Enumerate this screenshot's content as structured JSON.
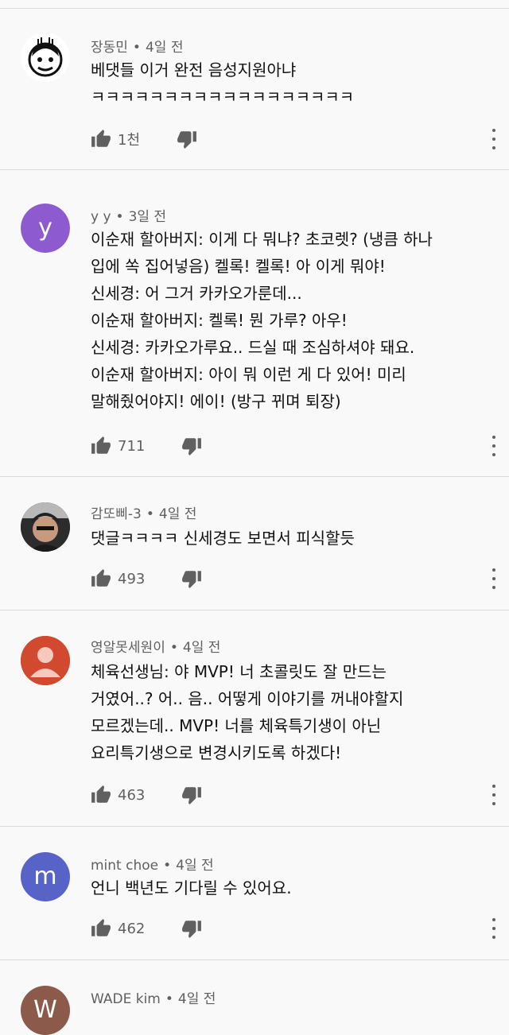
{
  "comments": [
    {
      "author": "장동민",
      "time": "4일 전",
      "text": "베댓들 이거 완전 음성지원아냐\nㅋㅋㅋㅋㅋㅋㅋㅋㅋㅋㅋㅋㅋㅋㅋㅋㅋㅋ",
      "likes": "1천",
      "avatar_letter": "",
      "avatar_color": "#ffffff"
    },
    {
      "author": "y y",
      "time": "3일 전",
      "text": "이순재 할아버지: 이게 다 뭐냐? 초코렛? (냉큼 하나\n입에 쏙 집어넣음) 켈록! 켈록! 아 이게 뭐야!\n신세경: 어 그거 카카오가룬데...\n이순재 할아버지: 켈록! 뭔 가루? 아우!\n신세경: 카카오가루요.. 드실 때 조심하셔야 돼요.\n이순재 할아버지: 아이 뭐 이런 게 다 있어! 미리\n말해줬어야지! 에이! (방구 뀌며 퇴장)",
      "likes": "711",
      "avatar_letter": "y",
      "avatar_color": "#8e5ad0"
    },
    {
      "author": "감또삐-3",
      "time": "4일 전",
      "text": "댓글ㅋㅋㅋㅋ 신세경도 보면서 피식할듯",
      "likes": "493",
      "avatar_letter": "",
      "avatar_color": "#3a3a3a"
    },
    {
      "author": "영알못세원이",
      "time": "4일 전",
      "text": "체육선생님: 야 MVP! 너 초콜릿도 잘 만드는\n거였어..? 어.. 음.. 어떻게 이야기를 꺼내야할지\n모르겠는데.. MVP! 너를 체육특기생이 아닌\n요리특기생으로 변경시키도록 하겠다!",
      "likes": "463",
      "avatar_letter": "",
      "avatar_color": "#d14a2f"
    },
    {
      "author": "mint choe",
      "time": "4일 전",
      "text": "언니 백년도 기다릴 수 있어요.",
      "likes": "462",
      "avatar_letter": "m",
      "avatar_color": "#5863c7"
    },
    {
      "author": "WADE kim",
      "time": "4일 전",
      "text": "",
      "likes": "",
      "avatar_letter": "W",
      "avatar_color": "#8b5a4a"
    }
  ]
}
